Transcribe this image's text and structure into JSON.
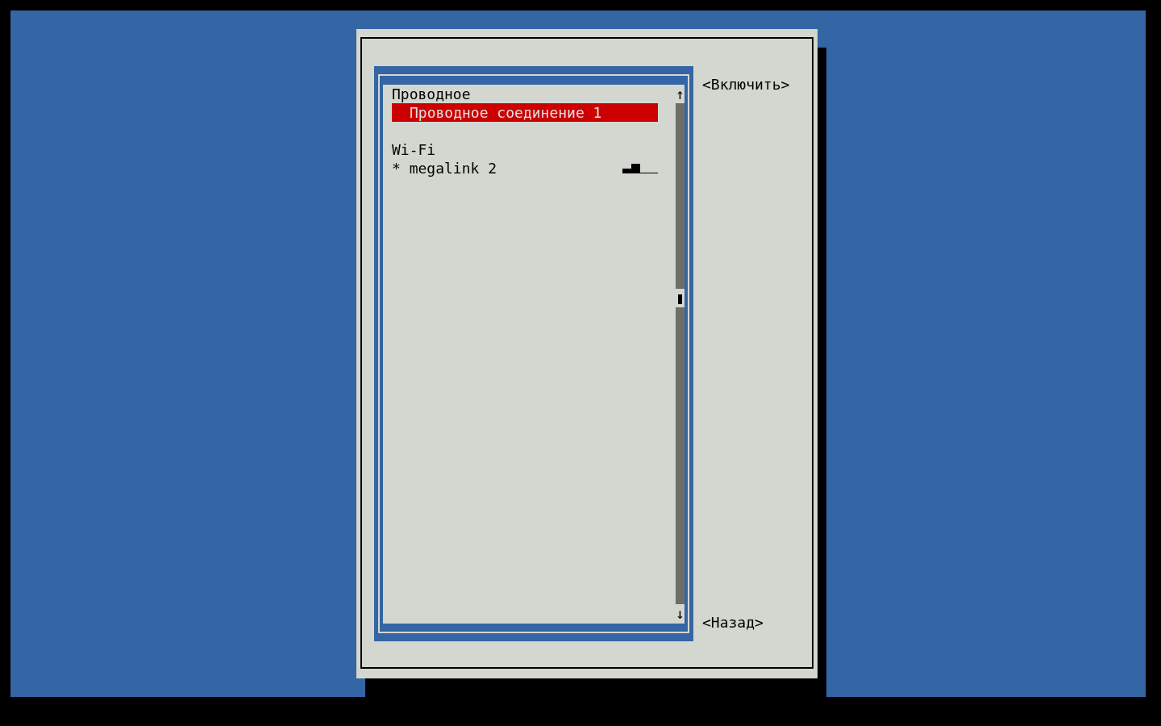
{
  "list": {
    "items": [
      {
        "kind": "header",
        "label": "Проводное"
      },
      {
        "kind": "connection",
        "label": "Проводное соединение 1",
        "selected": true
      },
      {
        "kind": "spacer"
      },
      {
        "kind": "header",
        "label": "Wi-Fi"
      },
      {
        "kind": "wifi",
        "marker": "*",
        "label": "megalink 2",
        "selected": false
      }
    ],
    "scroll_up": "↑",
    "scroll_down": "↓"
  },
  "buttons": [
    "<Включить>",
    "<Назад>"
  ]
}
